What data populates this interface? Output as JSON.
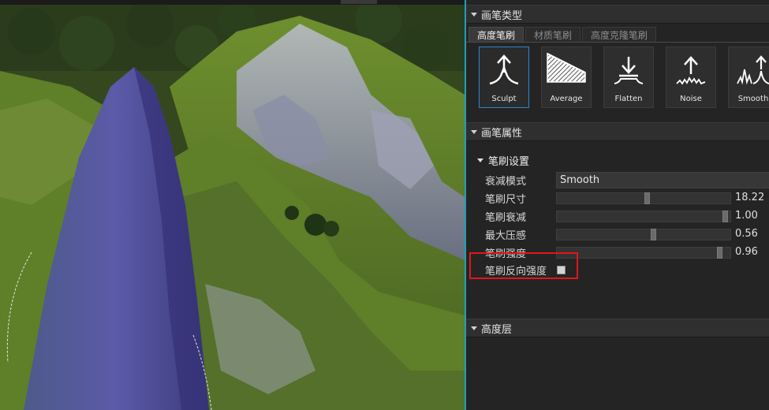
{
  "sections": {
    "brush_type": "画笔类型",
    "brush_props": "画笔属性",
    "height_layer": "高度层"
  },
  "tabs": [
    {
      "label": "高度笔刷",
      "active": true
    },
    {
      "label": "材质笔刷",
      "active": false
    },
    {
      "label": "高度克隆笔刷",
      "active": false
    }
  ],
  "brushes": [
    {
      "label": "Sculpt",
      "icon": "sculpt-icon",
      "selected": true
    },
    {
      "label": "Average",
      "icon": "average-icon",
      "selected": false
    },
    {
      "label": "Flatten",
      "icon": "flatten-icon",
      "selected": false
    },
    {
      "label": "Noise",
      "icon": "noise-icon",
      "selected": false
    },
    {
      "label": "Smooth",
      "icon": "smooth-icon",
      "selected": false
    }
  ],
  "brush_settings": {
    "group_label": "笔刷设置",
    "falloff_mode": {
      "label": "衰减模式",
      "value": "Smooth"
    },
    "brush_size": {
      "label": "笔刷尺寸",
      "value": "18.22",
      "fraction": 0.52
    },
    "brush_falloff": {
      "label": "笔刷衰减",
      "value": "1.00",
      "fraction": 0.985
    },
    "max_pressure": {
      "label": "最大压感",
      "value": "0.56",
      "fraction": 0.56
    },
    "brush_strength": {
      "label": "笔刷强度",
      "value": "0.96",
      "fraction": 0.955
    },
    "invert_strength": {
      "label": "笔刷反向强度",
      "checked": false
    }
  },
  "colors": {
    "accent": "#2a86d0",
    "highlight": "#e0161b",
    "divider": "#1fa0b8"
  }
}
